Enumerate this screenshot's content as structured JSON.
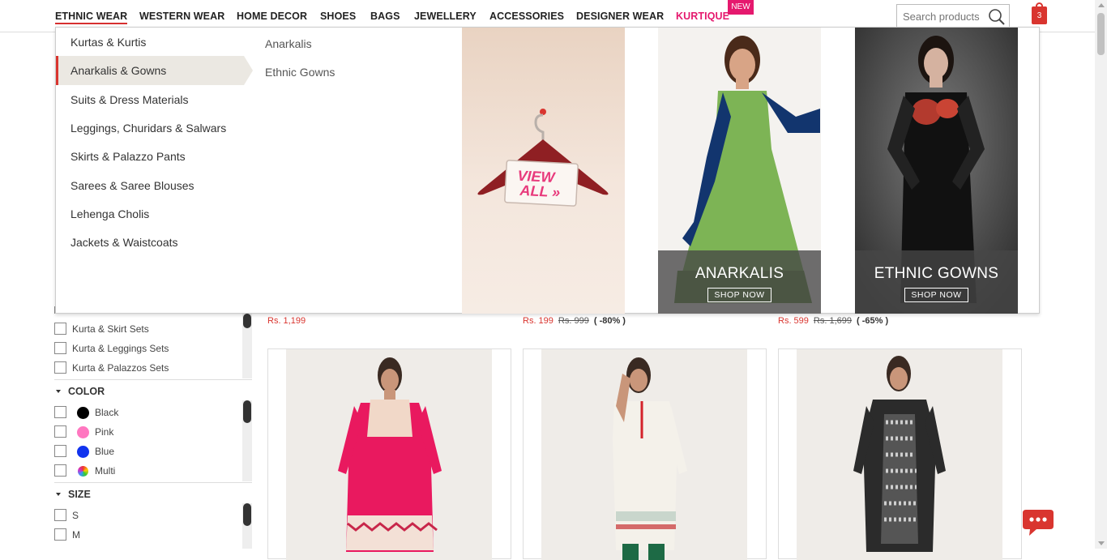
{
  "nav": {
    "items": [
      {
        "label": "ETHNIC WEAR"
      },
      {
        "label": "WESTERN WEAR"
      },
      {
        "label": "HOME DECOR"
      },
      {
        "label": "SHOES"
      },
      {
        "label": "BAGS"
      },
      {
        "label": "JEWELLERY"
      },
      {
        "label": "ACCESSORIES"
      },
      {
        "label": "DESIGNER WEAR"
      },
      {
        "label": "KURTIQUE"
      }
    ],
    "new_badge": "NEW",
    "search_placeholder": "Search products",
    "cart_count": "3",
    "accent_color": "#d9352f",
    "kurtique_color": "#e5196e"
  },
  "mega_menu": {
    "categories": [
      "Kurtas & Kurtis",
      "Anarkalis & Gowns",
      "Suits & Dress Materials",
      "Leggings, Churidars & Salwars",
      "Skirts & Palazzo Pants",
      "Sarees & Saree Blouses",
      "Lehenga Cholis",
      "Jackets & Waistcoats"
    ],
    "selected_category": "Anarkalis & Gowns",
    "subcategories": [
      "Anarkalis",
      "Ethnic Gowns"
    ],
    "view_all": {
      "line1": "VIEW",
      "line2": "ALL"
    },
    "promos": [
      {
        "title": "ANARKALIS",
        "button": "SHOP NOW"
      },
      {
        "title": "ETHNIC GOWNS",
        "button": "SHOP NOW"
      }
    ]
  },
  "filters": {
    "type_options": [
      "Kurta & Skirt Sets",
      "Kurta & Leggings Sets",
      "Kurta & Palazzos Sets"
    ],
    "color_heading": "COLOR",
    "colors": [
      {
        "label": "Black",
        "hex": "#000000"
      },
      {
        "label": "Pink",
        "hex": "#ff77c0"
      },
      {
        "label": "Blue",
        "hex": "#1133ee"
      },
      {
        "label": "Multi",
        "hex": "multi"
      }
    ],
    "size_heading": "SIZE",
    "sizes": [
      "S",
      "M"
    ]
  },
  "products": {
    "prices": [
      {
        "now": "Rs. 1,199",
        "was": "",
        "off": ""
      },
      {
        "now": "Rs. 199",
        "was": "Rs. 999",
        "off": "( -80% )"
      },
      {
        "now": "Rs. 599",
        "was": "Rs. 1,699",
        "off": "( -65% )"
      }
    ],
    "cards": [
      {
        "icon": "pink-kurta-image"
      },
      {
        "icon": "white-kurta-image"
      },
      {
        "icon": "black-kurta-image"
      }
    ]
  }
}
